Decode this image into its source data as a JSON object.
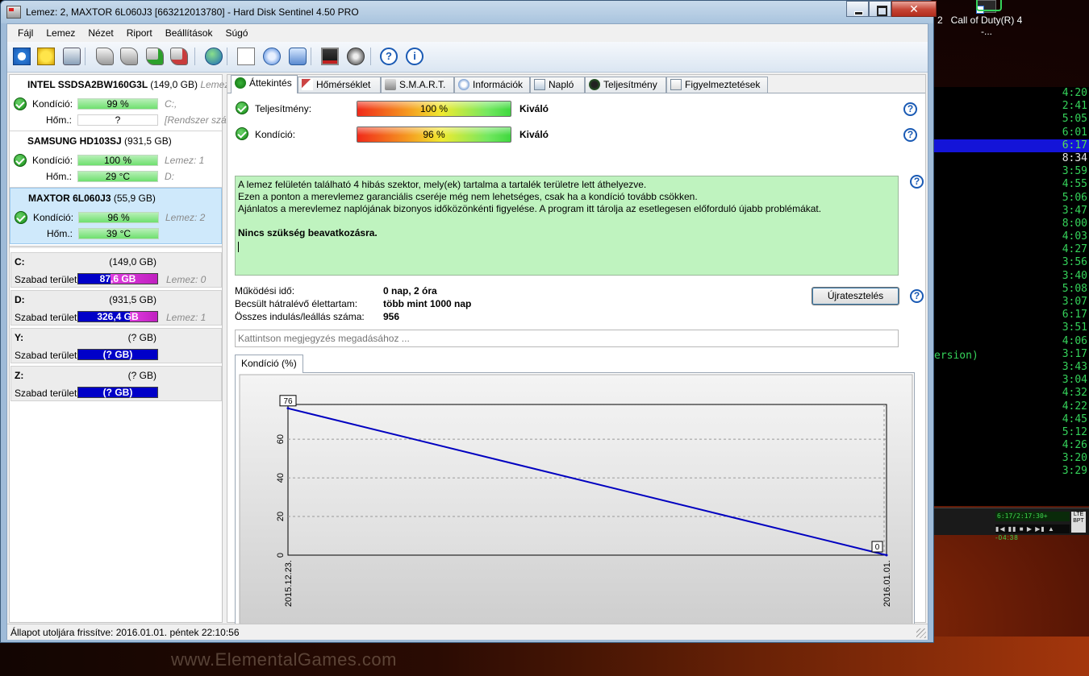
{
  "window": {
    "title": "Lemez: 2, MAXTOR 6L060J3 [663212013780]  -  Hard Disk Sentinel 4.50 PRO",
    "close_glyph": "✕"
  },
  "desktop": {
    "icon_label": "Call of Duty(R) 4 -...",
    "number_left": "2",
    "cmd_lines": [
      "4:20",
      "2:41",
      "5:05",
      "6:01",
      "6:17",
      "8:34",
      "3:59",
      "4:55",
      "5:06",
      "3:47",
      "8:00",
      "4:03",
      "4:27",
      "3:56",
      "3:40",
      "5:08",
      "3:07",
      "6:17",
      "3:51",
      "4:06",
      "3:17",
      "3:43",
      "3:04",
      "4:32",
      "4:22",
      "4:45",
      "5:12",
      "4:26",
      "3:20",
      "3:29"
    ],
    "cmd_version_text": "ersion)",
    "player_time": "6:17/2:17:30+",
    "player_remaining": "-04:38",
    "player_logo": "LTE BPT",
    "watermark": "www.ElementalGames.com"
  },
  "menu": [
    "Fájl",
    "Lemez",
    "Nézet",
    "Riport",
    "Beállítások",
    "Súgó"
  ],
  "toolbar_icons": [
    "refresh-icon",
    "warning-icon",
    "disk-icon",
    "usb-drive-icon",
    "usb-drive-add-icon",
    "usb-drive-check-icon",
    "usb-drive-remove-icon",
    "globe-icon",
    "document-icon",
    "sync-icon",
    "network-icon",
    "monitor-icon",
    "speaker-icon",
    "help-icon",
    "info-icon"
  ],
  "disks": [
    {
      "name": "INTEL SSDSA2BW160G3L",
      "cap": "(149,0 GB)",
      "overflow": "Lemez",
      "cond_label": "Kondíció:",
      "cond": "99 %",
      "cond_note": "C:,",
      "temp_label": "Hőm.:",
      "temp": "?",
      "temp_note": "[Rendszer szá"
    },
    {
      "name": "SAMSUNG HD103SJ",
      "cap": "(931,5 GB)",
      "overflow": "",
      "cond_label": "Kondíció:",
      "cond": "100 %",
      "cond_note": "Lemez: 1",
      "temp_label": "Hőm.:",
      "temp": "29 °C",
      "temp_note": "D:"
    },
    {
      "name": "MAXTOR 6L060J3",
      "cap": "(55,9 GB)",
      "overflow": "",
      "cond_label": "Kondíció:",
      "cond": "96 %",
      "cond_note": "Lemez: 2",
      "temp_label": "Hőm.:",
      "temp": "39 °C",
      "temp_note": ""
    }
  ],
  "partitions": [
    {
      "name": "C:",
      "cap": "(149,0 GB)",
      "label": "Szabad terület",
      "free": "87,6 GB",
      "used_fraction": 0.588,
      "note": "Lemez: 0"
    },
    {
      "name": "D:",
      "cap": "(931,5 GB)",
      "label": "Szabad terület",
      "free": "326,4 GB",
      "used_fraction": 0.35,
      "note": "Lemez: 1"
    },
    {
      "name": "Y:",
      "cap": "(? GB)",
      "label": "Szabad terület",
      "free": "(? GB)",
      "used_fraction": 0,
      "note": ""
    },
    {
      "name": "Z:",
      "cap": "(? GB)",
      "label": "Szabad terület",
      "free": "(? GB)",
      "used_fraction": 0,
      "note": ""
    }
  ],
  "tabs": [
    "Áttekintés",
    "Hőmérséklet",
    "S.M.A.R.T.",
    "Információk",
    "Napló",
    "Teljesítmény",
    "Figyelmeztetések"
  ],
  "overview": {
    "perf_label": "Teljesítmény:",
    "perf_value": "100 %",
    "perf_rating": "Kiváló",
    "cond_label": "Kondíció:",
    "cond_value": "96 %",
    "cond_rating": "Kiváló",
    "message_lines": [
      "A lemez felületén található 4 hibás szektor, mely(ek) tartalma a tartalék területre lett áthelyezve.",
      "Ezen a ponton a merevlemez garanciális cseréje még nem lehetséges, csak ha a kondíció tovább csökken.",
      "Ajánlatos a merevlemez naplójának bizonyos időközönkénti figyelése. A program itt tárolja az esetlegesen előforduló újabb problémákat."
    ],
    "message_bold": "Nincs szükség beavatkozásra.",
    "uptime_label": "Működési idő:",
    "uptime_value": "0 nap, 2 óra",
    "life_label": "Becsült hátralévő élettartam:",
    "life_value": "több mint 1000 nap",
    "starts_label": "Összes indulás/leállás száma:",
    "starts_value": "956",
    "retest_button": "Újratesztelés",
    "note_placeholder": "Kattintson megjegyzés megadásához ...",
    "chart_tab": "Kondíció  (%)"
  },
  "chart_data": {
    "type": "line",
    "x": [
      "2015.12.23.",
      "2016.01.01."
    ],
    "values": [
      76,
      0
    ],
    "data_labels": [
      "76",
      "0"
    ],
    "ylim": [
      0,
      78
    ],
    "yticks": [
      0,
      20,
      40,
      60
    ],
    "grid": true,
    "line_color": "#0000c0"
  },
  "status": {
    "text": "Állapot utoljára frissítve: 2016.01.01. péntek 22:10:56"
  }
}
